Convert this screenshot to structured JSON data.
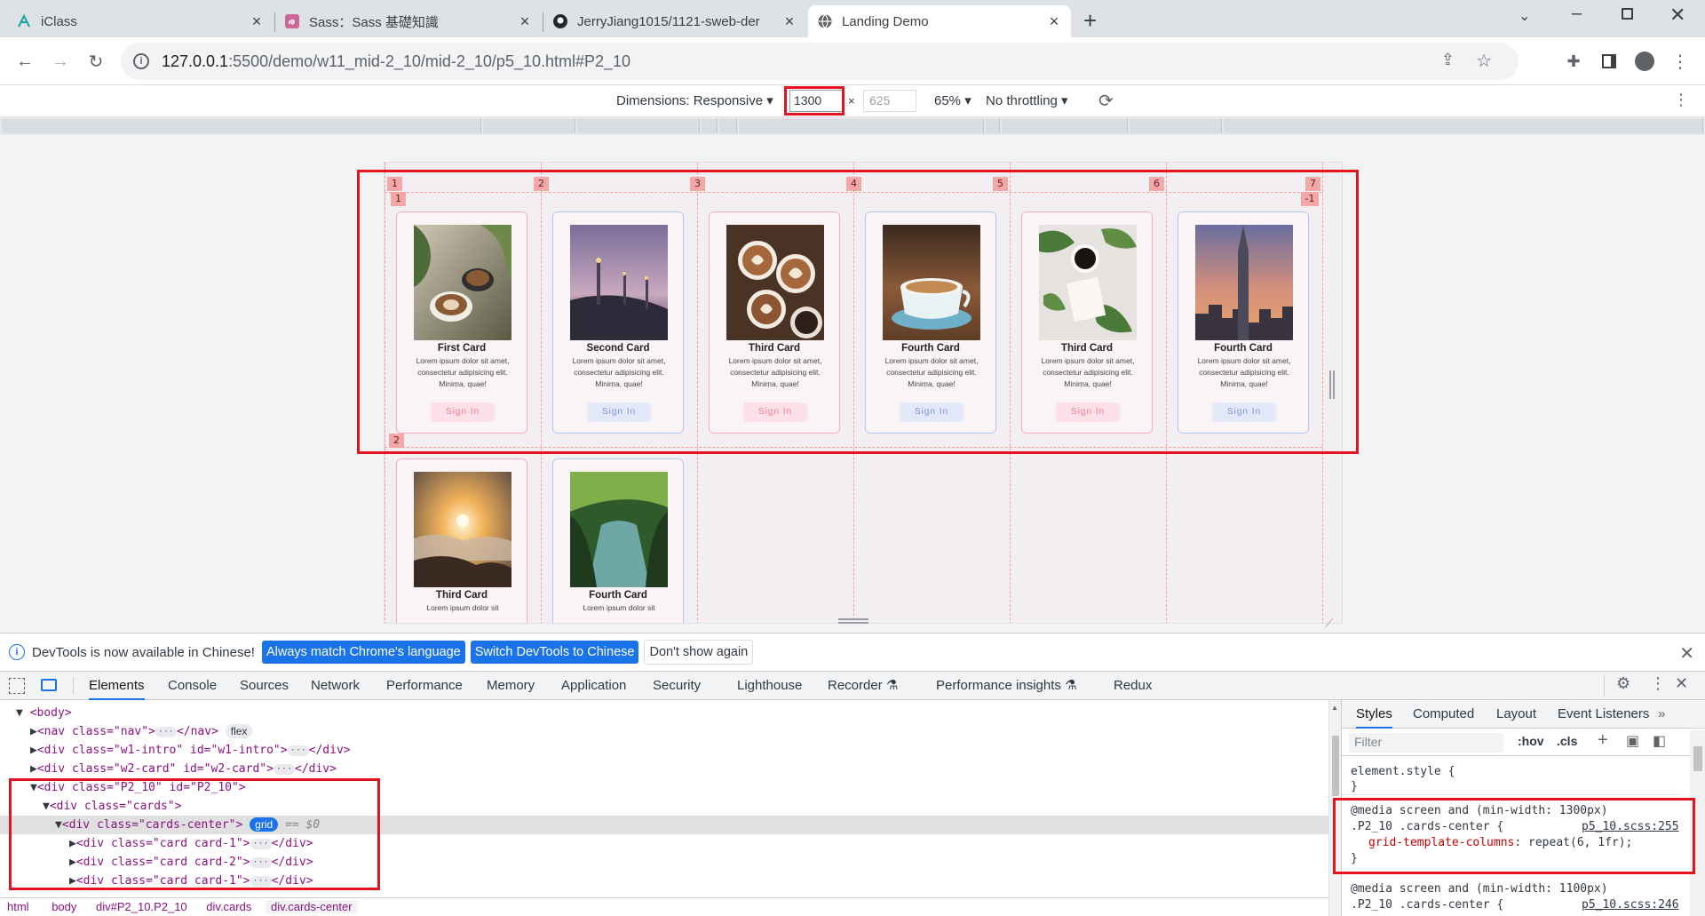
{
  "browser": {
    "tabs": [
      {
        "title": "iClass",
        "icon": "iclass-icon"
      },
      {
        "title": "Sass：Sass 基礎知識",
        "icon": "sass-icon"
      },
      {
        "title": "JerryJiang1015/1121-sweb-der",
        "icon": "github-icon"
      },
      {
        "title": "Landing Demo",
        "icon": "globe-icon",
        "active": true
      }
    ],
    "new_tab": "+",
    "url_host": "127.0.0.1",
    "url_rest": ":5500/demo/w11_mid-2_10/mid-2_10/p5_10.html#P2_10"
  },
  "device_toolbar": {
    "dimensions_label": "Dimensions: Responsive",
    "width": "1300",
    "times": "×",
    "height_placeholder": "625",
    "zoom": "65%",
    "throttling": "No throttling"
  },
  "grid_overlay": {
    "column_labels": [
      "1",
      "2",
      "3",
      "4",
      "5",
      "6",
      "7"
    ],
    "row_label_1": "1",
    "row_label_2": "2",
    "neg_label": "-1"
  },
  "cards": [
    {
      "title": "First Card",
      "style": "pink",
      "image": "coffee-plant-photo",
      "body": "Lorem ipsum dolor sit amet, consectetur adipisicing elit. Minima, quae!",
      "button": "Sign In"
    },
    {
      "title": "Second Card",
      "style": "blue",
      "image": "bridge-dusk-photo",
      "body": "Lorem ipsum dolor sit amet, consectetur adipisicing elit. Minima, quae!",
      "button": "Sign In"
    },
    {
      "title": "Third Card",
      "style": "pink",
      "image": "latte-art-photo",
      "body": "Lorem ipsum dolor sit amet, consectetur adipisicing elit. Minima, quae!",
      "button": "Sign In"
    },
    {
      "title": "Fourth Card",
      "style": "blue",
      "image": "espresso-cup-photo",
      "body": "Lorem ipsum dolor sit amet, consectetur adipisicing elit. Minima, quae!",
      "button": "Sign In"
    },
    {
      "title": "Third Card",
      "style": "pink",
      "image": "coffee-flatlay-photo",
      "body": "Lorem ipsum dolor sit amet, consectetur adipisicing elit. Minima, quae!",
      "button": "Sign In"
    },
    {
      "title": "Fourth Card",
      "style": "blue",
      "image": "taipei-101-photo",
      "body": "Lorem ipsum dolor sit amet, consectetur adipisicing elit. Minima, quae!",
      "button": "Sign In"
    },
    {
      "title": "Third Card",
      "style": "pink",
      "image": "sunset-mountain-photo",
      "body": "Lorem ipsum dolor sit",
      "button": ""
    },
    {
      "title": "Fourth Card",
      "style": "blue",
      "image": "forest-stream-photo",
      "body": "Lorem ipsum dolor sit",
      "button": ""
    }
  ],
  "infobar": {
    "message": "DevTools is now available in Chinese!",
    "btn_match": "Always match Chrome's language",
    "btn_switch": "Switch DevTools to Chinese",
    "btn_dont": "Don't show again"
  },
  "devtools_tabs": [
    "Elements",
    "Console",
    "Sources",
    "Network",
    "Performance",
    "Memory",
    "Application",
    "Security",
    "Lighthouse",
    "Recorder",
    "Performance insights",
    "Redux"
  ],
  "elements": {
    "lines": [
      {
        "indent": 0,
        "arrow": "▼",
        "html": "<body>"
      },
      {
        "indent": 1,
        "arrow": "▶",
        "open": "<nav class=\"nav\">",
        "close": "</nav>",
        "pill": "flex"
      },
      {
        "indent": 1,
        "arrow": "▶",
        "open": "<div class=\"w1-intro\" id=\"w1-intro\">",
        "close": "</div>"
      },
      {
        "indent": 1,
        "arrow": "▶",
        "open": "<div class=\"w2-card\" id=\"w2-card\">",
        "close": "</div>"
      },
      {
        "indent": 1,
        "arrow": "▼",
        "open": "<div class=\"P2_10\" id=\"P2_10\">"
      },
      {
        "indent": 2,
        "arrow": "▼",
        "open": "<div class=\"cards\">"
      },
      {
        "indent": 3,
        "arrow": "▼",
        "open": "<div class=\"cards-center\">",
        "pill": "grid",
        "suffix": "== $0",
        "selected": true
      },
      {
        "indent": 4,
        "arrow": "▶",
        "open": "<div class=\"card card-1\">",
        "close": "</div>"
      },
      {
        "indent": 4,
        "arrow": "▶",
        "open": "<div class=\"card card-2\">",
        "close": "</div>"
      },
      {
        "indent": 4,
        "arrow": "▶",
        "open": "<div class=\"card card-1\">",
        "close": "</div>"
      }
    ],
    "breadcrumbs": [
      "html",
      "body",
      "div#P2_10.P2_10",
      "div.cards",
      "div.cards-center"
    ]
  },
  "styles": {
    "tabs": [
      "Styles",
      "Computed",
      "Layout",
      "Event Listeners"
    ],
    "filter_placeholder": "Filter",
    "hov": ":hov",
    "cls": ".cls",
    "element_style": "element.style {",
    "close_brace": "}",
    "media1": "@media screen and (min-width: 1300px)",
    "selector1": ".P2_10 .cards-center {",
    "source1": "p5_10.scss:255",
    "prop_name": "grid-template-columns",
    "prop_value": "repeat(6, 1fr);",
    "media2": "@media screen and (min-width: 1100px)",
    "selector2": ".P2_10 .cards-center {",
    "source2": "p5_10.scss:246"
  },
  "colors": {
    "highlight_red": "#e3141e",
    "grid_line": "#f2a0a0",
    "card_pink_border": "#f5aeb9",
    "card_blue_border": "#b5c5f0",
    "accent_blue": "#1a73e8"
  }
}
